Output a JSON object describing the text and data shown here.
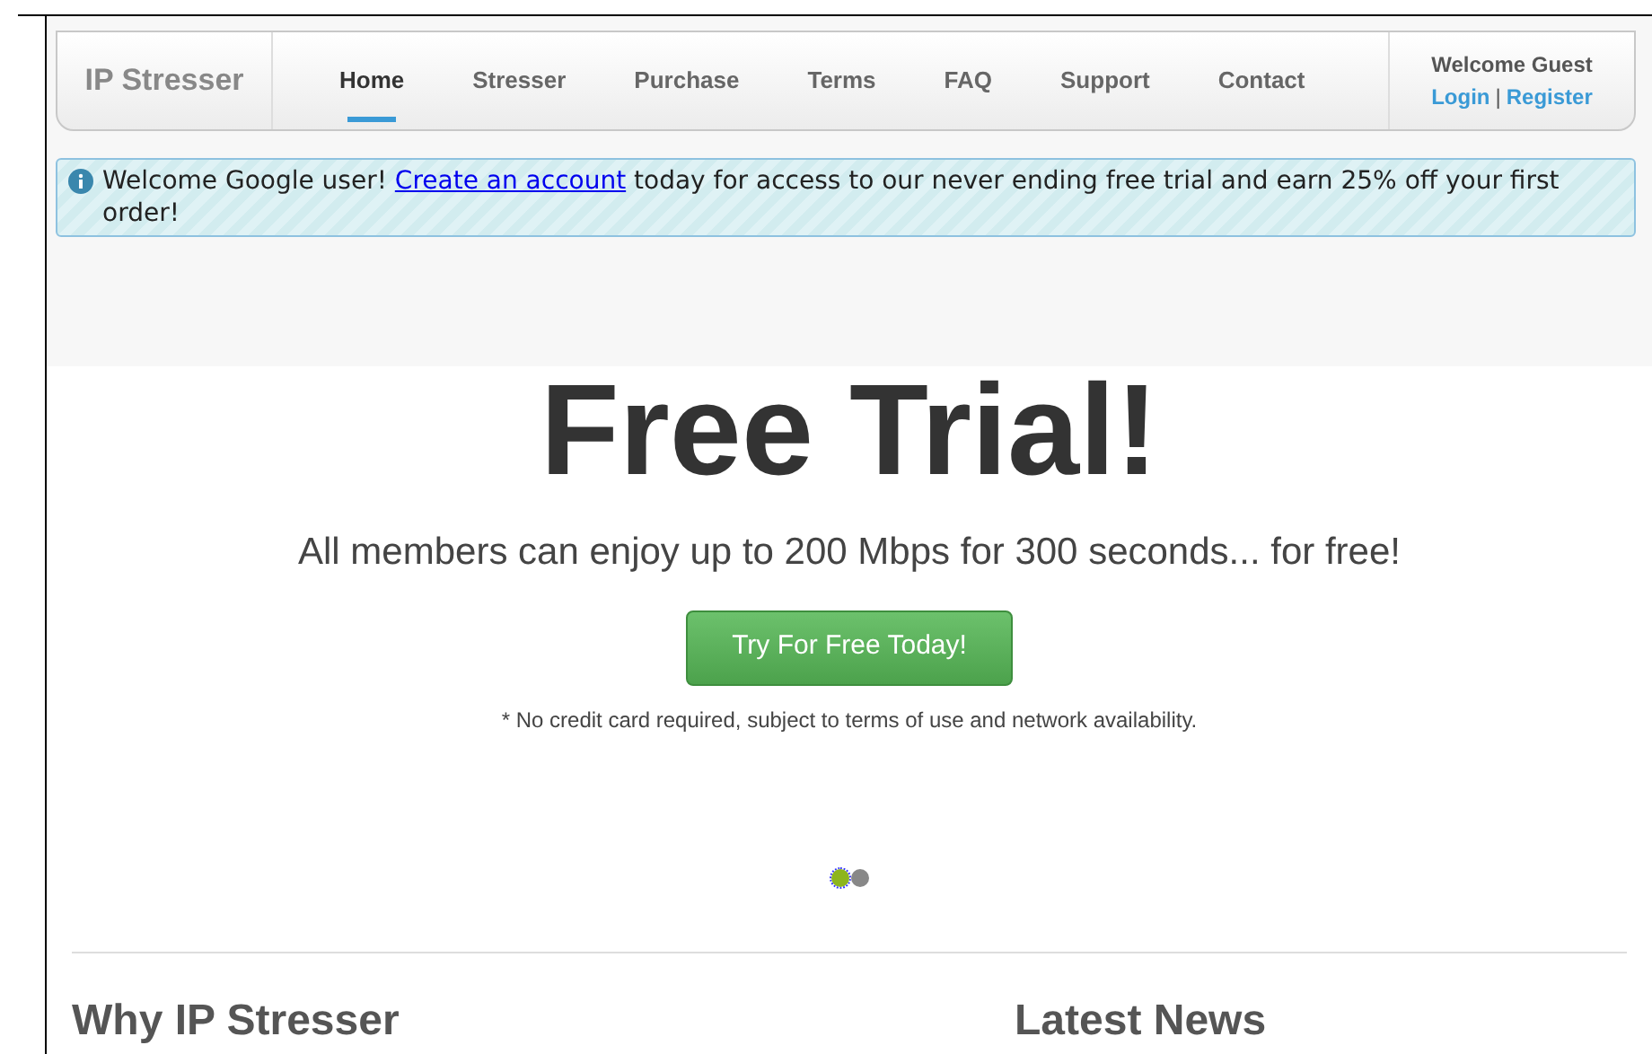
{
  "nav": {
    "brand": "IP Stresser",
    "items": [
      {
        "label": "Home",
        "selected": true
      },
      {
        "label": "Stresser",
        "selected": false
      },
      {
        "label": "Purchase",
        "selected": false
      },
      {
        "label": "Terms",
        "selected": false
      },
      {
        "label": "FAQ",
        "selected": false
      },
      {
        "label": "Support",
        "selected": false
      },
      {
        "label": "Contact",
        "selected": false
      }
    ],
    "welcome": "Welcome Guest",
    "login": "Login",
    "separator": "|",
    "register": "Register"
  },
  "alert": {
    "before": "Welcome Google user!",
    "link": "Create an account",
    "after": "today for access to our never ending free trial and earn 25% off your first order!"
  },
  "hero": {
    "title": "Free Trial!",
    "subtitle": "All members can enjoy up to 200 Mbps for 300 seconds... for free!",
    "button": "Try For Free Today!",
    "note": "* No credit card required, subject to terms of use and network availability.",
    "dots": [
      {
        "selected": true
      },
      {
        "selected": false
      }
    ]
  },
  "sections": [
    "Why IP Stresser",
    "Latest News"
  ]
}
